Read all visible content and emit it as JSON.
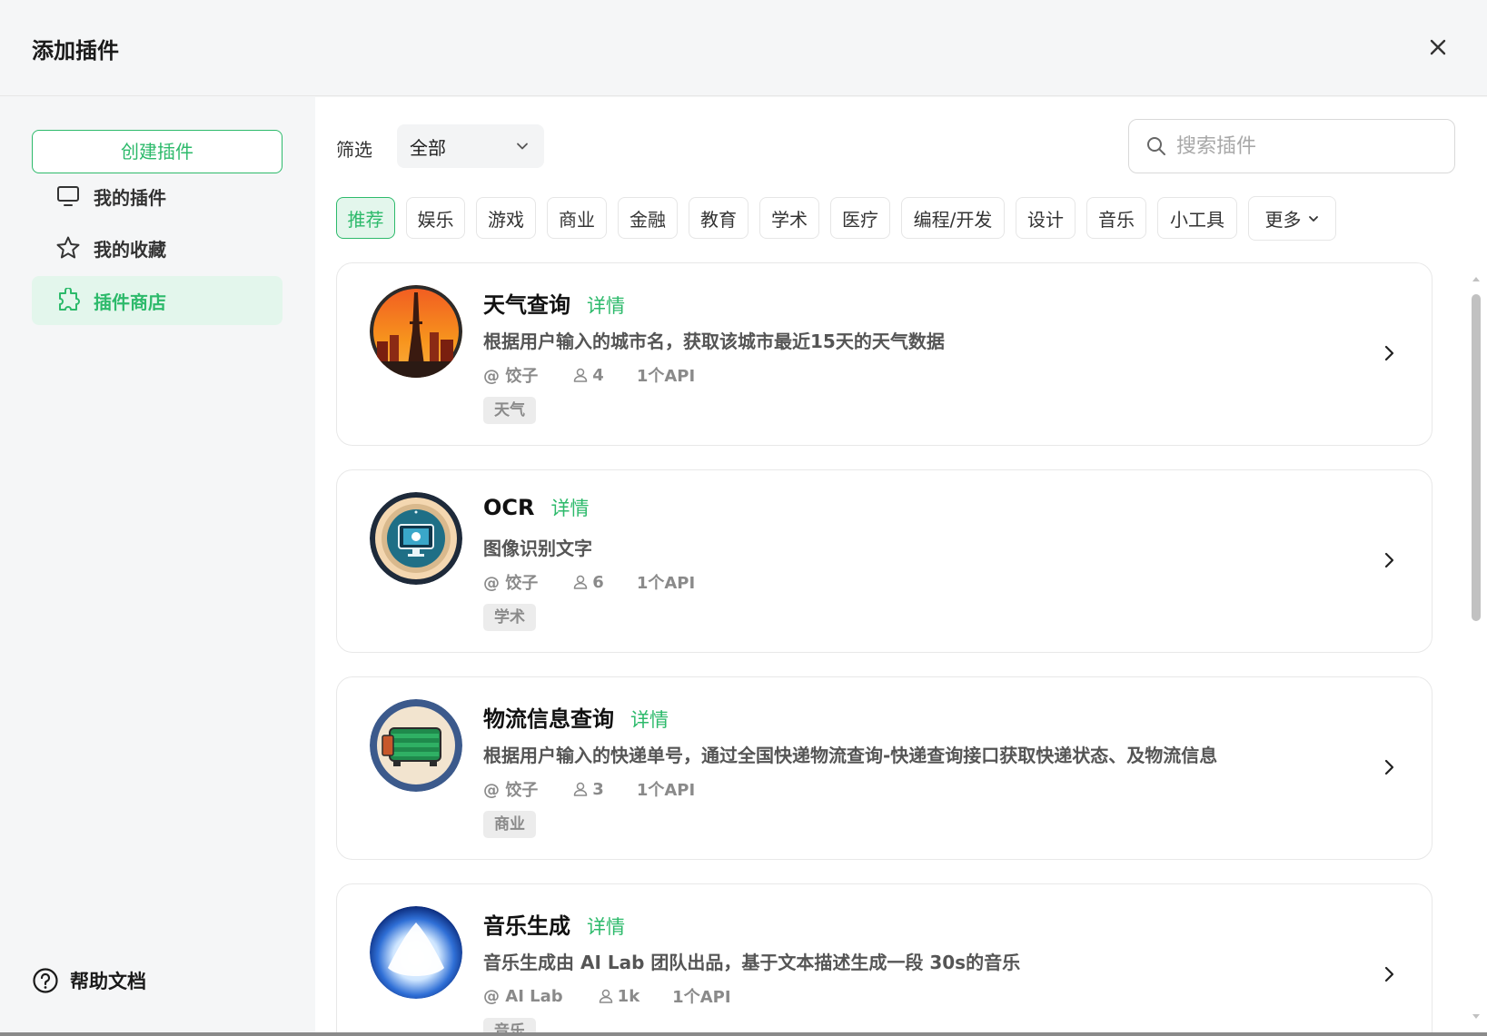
{
  "dialog": {
    "title": "添加插件"
  },
  "sidebar": {
    "create_label": "创建插件",
    "items": [
      {
        "label": "我的插件",
        "icon": "monitor-icon",
        "active": false
      },
      {
        "label": "我的收藏",
        "icon": "star-icon",
        "active": false
      },
      {
        "label": "插件商店",
        "icon": "puzzle-icon",
        "active": true
      }
    ],
    "help_label": "帮助文档"
  },
  "filter": {
    "label": "筛选",
    "selected": "全部"
  },
  "search": {
    "placeholder": "搜索插件"
  },
  "categories": [
    {
      "label": "推荐",
      "active": true
    },
    {
      "label": "娱乐"
    },
    {
      "label": "游戏"
    },
    {
      "label": "商业"
    },
    {
      "label": "金融"
    },
    {
      "label": "教育"
    },
    {
      "label": "学术"
    },
    {
      "label": "医疗"
    },
    {
      "label": "编程/开发"
    },
    {
      "label": "设计"
    },
    {
      "label": "音乐"
    },
    {
      "label": "小工具"
    },
    {
      "label": "更多"
    }
  ],
  "detail_label": "详情",
  "plugins": [
    {
      "title": "天气查询",
      "desc": "根据用户输入的城市名，获取该城市最近15天的天气数据",
      "author": "@ 饺子",
      "users": "4",
      "apis": "1个API",
      "tag": "天气",
      "icon": "city-tower-icon"
    },
    {
      "title": "OCR",
      "desc": "图像识别文字",
      "author": "@ 饺子",
      "users": "6",
      "apis": "1个API",
      "tag": "学术",
      "icon": "monitor-scan-icon"
    },
    {
      "title": "物流信息查询",
      "desc": "根据用户输入的快递单号，通过全国快递物流查询-快递查询接口获取快递状态、及物流信息",
      "author": "@ 饺子",
      "users": "3",
      "apis": "1个API",
      "tag": "商业",
      "icon": "delivery-box-icon"
    },
    {
      "title": "音乐生成",
      "desc": "音乐生成由 AI Lab 团队出品，基于文本描述生成一段 30s的音乐",
      "author": "@ AI Lab",
      "users": "1k",
      "apis": "1个API",
      "tag": "音乐",
      "icon": "blue-orb-icon"
    }
  ],
  "colors": {
    "accent": "#2dba6b",
    "accent_bg": "#e3f6ec"
  }
}
